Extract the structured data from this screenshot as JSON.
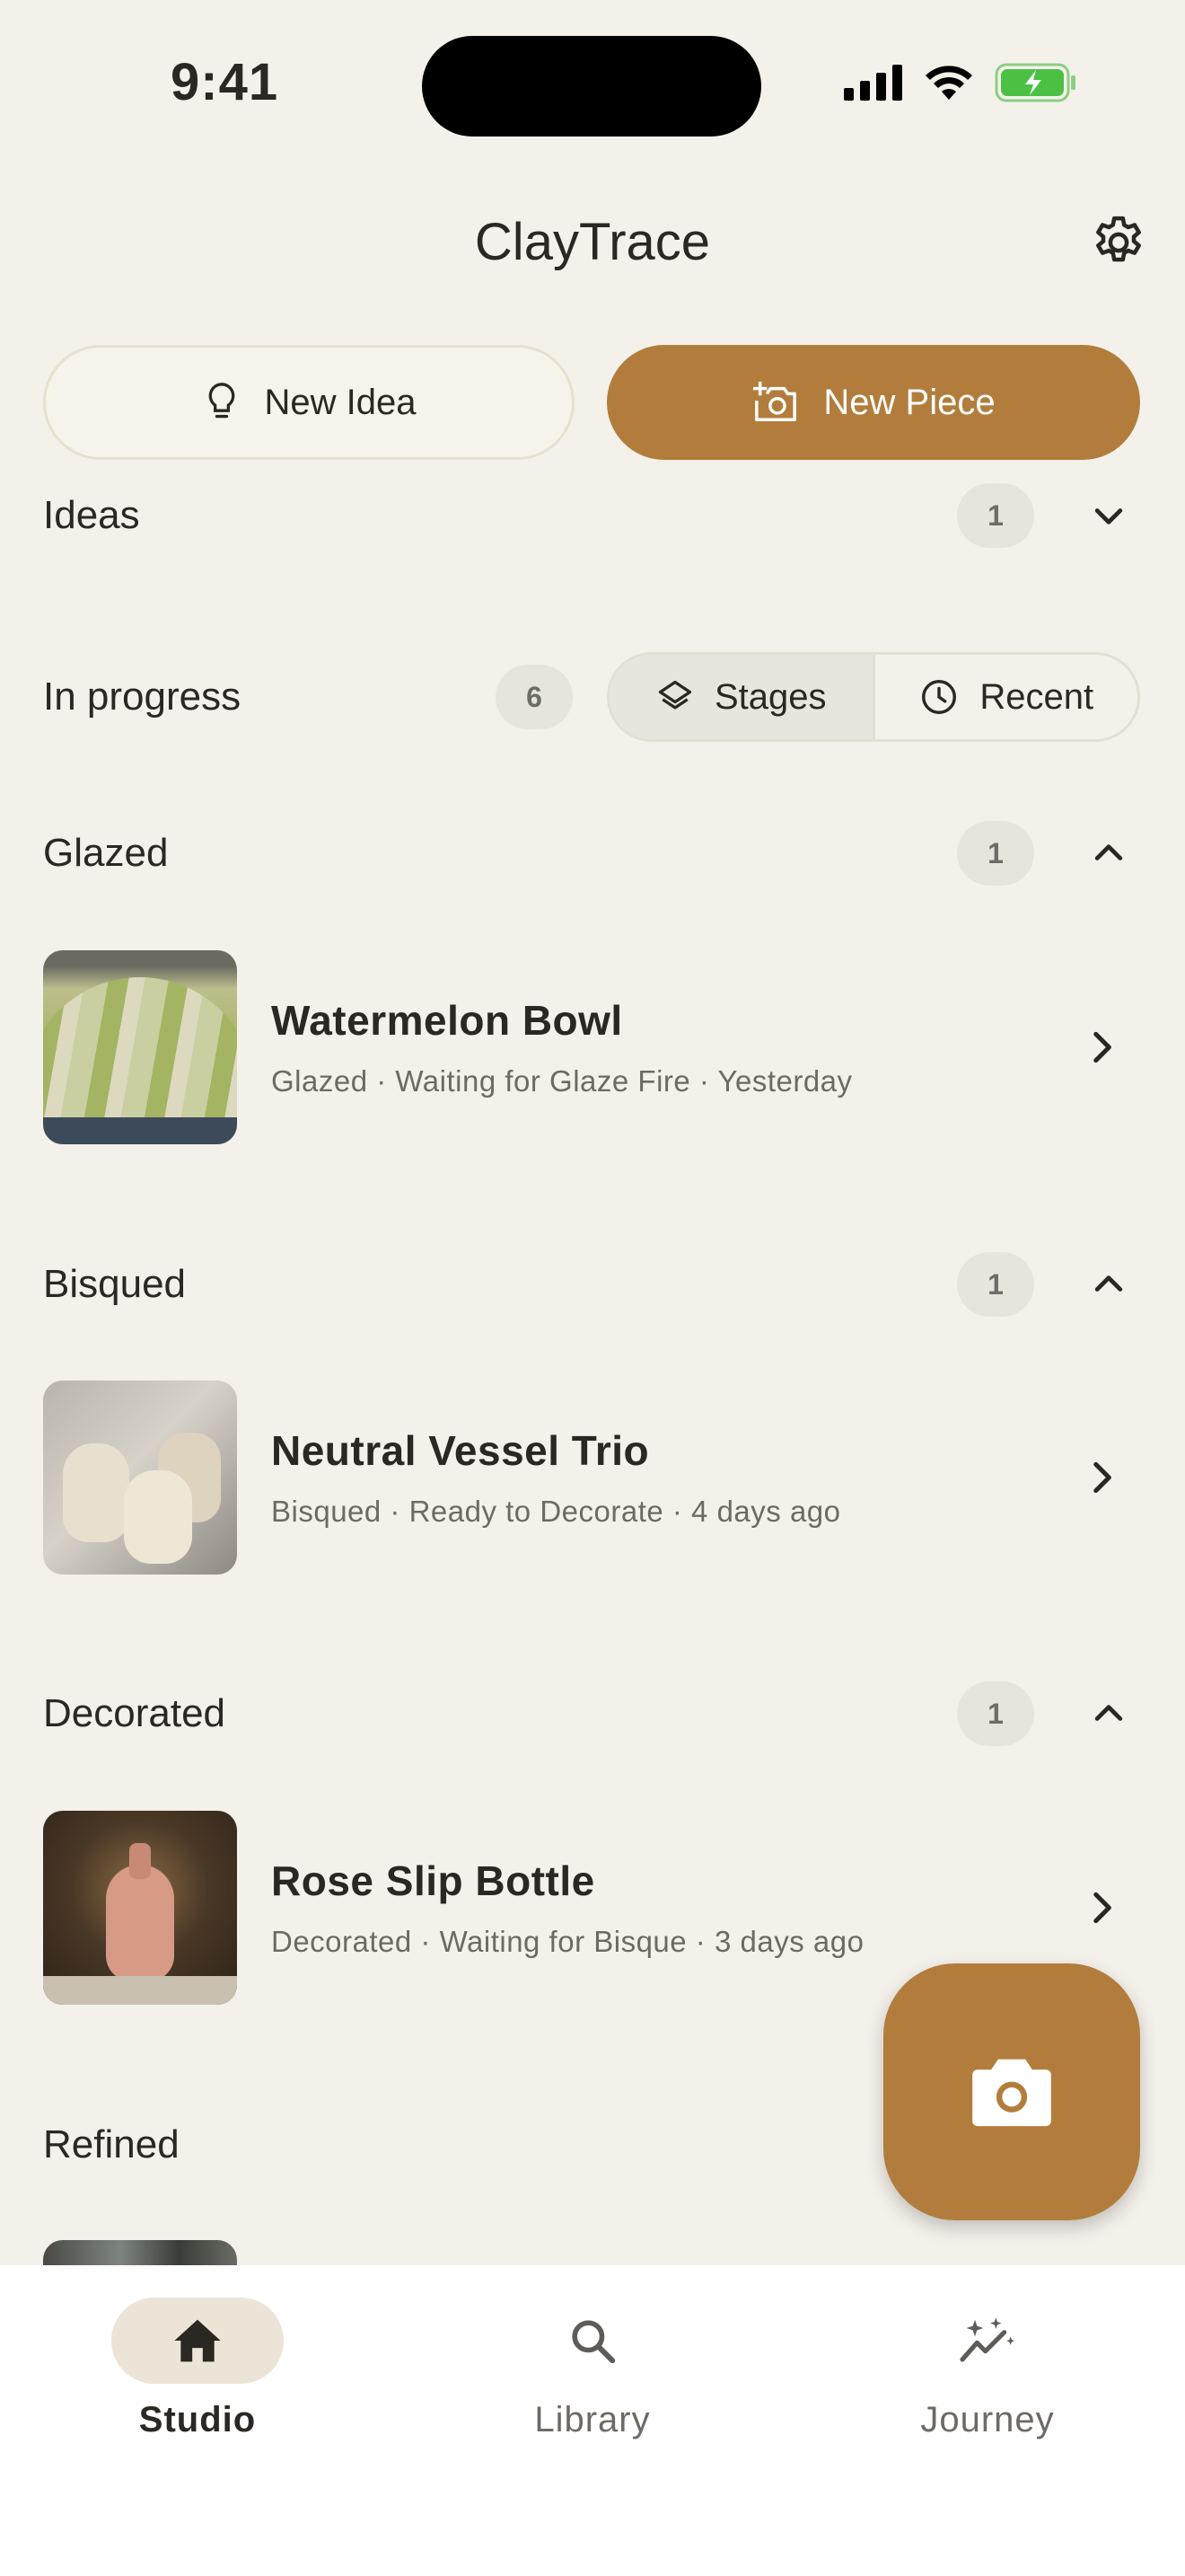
{
  "status_bar": {
    "time": "9:41"
  },
  "header": {
    "title": "ClayTrace"
  },
  "actions": {
    "new_idea": "New Idea",
    "new_piece": "New Piece"
  },
  "ideas": {
    "label": "Ideas",
    "count": "1"
  },
  "in_progress": {
    "label": "In progress",
    "count": "6",
    "toggle": {
      "stages": "Stages",
      "recent": "Recent",
      "selected": "Stages"
    }
  },
  "groups": [
    {
      "label": "Glazed",
      "count": "1",
      "item": {
        "title": "Watermelon Bowl",
        "subtitle": "Glazed · Waiting for Glaze Fire · Yesterday"
      }
    },
    {
      "label": "Bisqued",
      "count": "1",
      "item": {
        "title": "Neutral Vessel Trio",
        "subtitle": "Bisqued · Ready to Decorate · 4 days ago"
      }
    },
    {
      "label": "Decorated",
      "count": "1",
      "item": {
        "title": "Rose Slip Bottle",
        "subtitle": "Decorated · Waiting for Bisque · 3 days ago"
      }
    },
    {
      "label": "Refined"
    }
  ],
  "nav": {
    "studio": "Studio",
    "library": "Library",
    "journey": "Journey",
    "active": "Studio"
  },
  "colors": {
    "accent": "#b27d3c",
    "background": "#f4f1ea",
    "text": "#2b2722",
    "muted": "#6d6a63"
  },
  "icons": [
    "settings-gear-icon",
    "lightbulb-icon",
    "add-photo-icon",
    "chevron-down-icon",
    "chevron-up-icon",
    "chevron-right-icon",
    "layers-icon",
    "clock-icon",
    "camera-icon",
    "home-icon",
    "search-icon",
    "sparkle-chart-icon"
  ]
}
